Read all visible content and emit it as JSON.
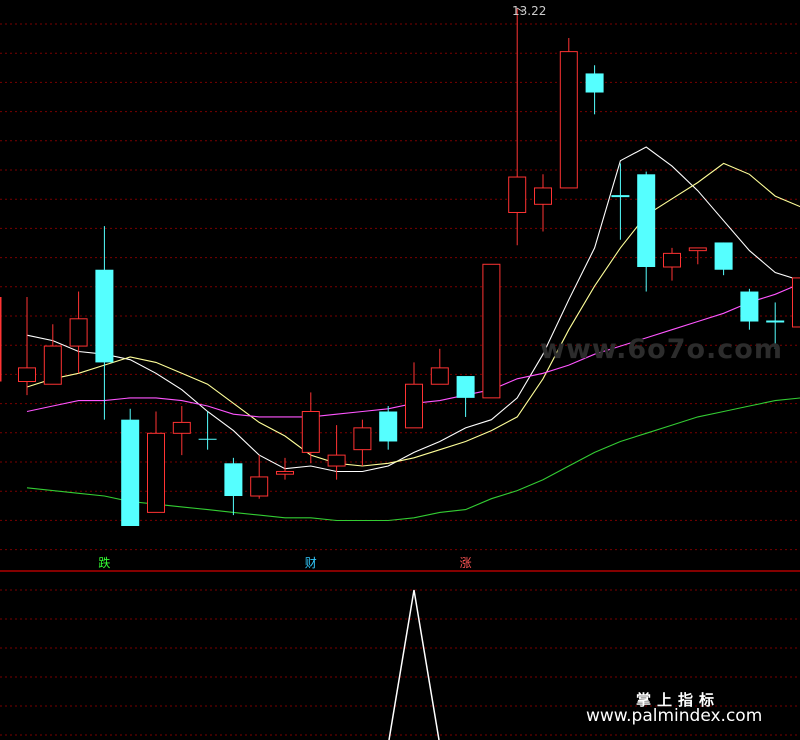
{
  "chart_data": {
    "type": "candlestick",
    "candles": [
      {
        "o": 11.9,
        "h": 12.16,
        "l": 11.8,
        "c": 11.85,
        "dir": "up"
      },
      {
        "o": 11.84,
        "h": 12.06,
        "l": 11.84,
        "c": 11.98,
        "dir": "up"
      },
      {
        "o": 11.98,
        "h": 12.18,
        "l": 11.88,
        "c": 12.08,
        "dir": "up"
      },
      {
        "o": 12.26,
        "h": 12.42,
        "l": 11.71,
        "c": 11.92,
        "dir": "down"
      },
      {
        "o": 11.71,
        "h": 11.75,
        "l": 11.33,
        "c": 11.32,
        "dir": "down"
      },
      {
        "o": 11.37,
        "h": 11.74,
        "l": 11.37,
        "c": 11.66,
        "dir": "up"
      },
      {
        "o": 11.66,
        "h": 11.76,
        "l": 11.58,
        "c": 11.7,
        "dir": "up"
      },
      {
        "o": 11.64,
        "h": 11.74,
        "l": 11.6,
        "c": 11.64,
        "dir": "down"
      },
      {
        "o": 11.55,
        "h": 11.57,
        "l": 11.36,
        "c": 11.43,
        "dir": "down"
      },
      {
        "o": 11.43,
        "h": 11.58,
        "l": 11.42,
        "c": 11.5,
        "dir": "up"
      },
      {
        "o": 11.51,
        "h": 11.57,
        "l": 11.49,
        "c": 11.52,
        "dir": "up"
      },
      {
        "o": 11.59,
        "h": 11.81,
        "l": 11.55,
        "c": 11.74,
        "dir": "up"
      },
      {
        "o": 11.54,
        "h": 11.69,
        "l": 11.49,
        "c": 11.58,
        "dir": "up"
      },
      {
        "o": 11.6,
        "h": 11.71,
        "l": 11.54,
        "c": 11.68,
        "dir": "up"
      },
      {
        "o": 11.74,
        "h": 11.76,
        "l": 11.6,
        "c": 11.63,
        "dir": "down"
      },
      {
        "o": 11.68,
        "h": 11.92,
        "l": 11.68,
        "c": 11.84,
        "dir": "up"
      },
      {
        "o": 11.84,
        "h": 11.97,
        "l": 11.84,
        "c": 11.9,
        "dir": "up"
      },
      {
        "o": 11.87,
        "h": 11.82,
        "l": 11.72,
        "c": 11.79,
        "dir": "down"
      },
      {
        "o": 11.79,
        "h": 12.28,
        "l": 11.79,
        "c": 12.28,
        "dir": "up"
      },
      {
        "o": 12.47,
        "h": 13.22,
        "l": 12.35,
        "c": 12.6,
        "dir": "up"
      },
      {
        "o": 12.5,
        "h": 12.61,
        "l": 12.4,
        "c": 12.56,
        "dir": "up"
      },
      {
        "o": 12.56,
        "h": 13.11,
        "l": 12.56,
        "c": 13.06,
        "dir": "up"
      },
      {
        "o": 12.98,
        "h": 13.01,
        "l": 12.83,
        "c": 12.91,
        "dir": "down"
      },
      {
        "o": 12.53,
        "h": 12.65,
        "l": 12.37,
        "c": 12.53,
        "dir": "doji"
      },
      {
        "o": 12.61,
        "h": 12.62,
        "l": 12.18,
        "c": 12.27,
        "dir": "down"
      },
      {
        "o": 12.27,
        "h": 12.34,
        "l": 12.22,
        "c": 12.32,
        "dir": "up"
      },
      {
        "o": 12.34,
        "h": 12.34,
        "l": 12.28,
        "c": 12.33,
        "dir": "up"
      },
      {
        "o": 12.36,
        "h": 12.36,
        "l": 12.24,
        "c": 12.26,
        "dir": "down"
      },
      {
        "o": 12.18,
        "h": 12.19,
        "l": 12.04,
        "c": 12.07,
        "dir": "down"
      },
      {
        "o": 12.07,
        "h": 12.14,
        "l": 11.97,
        "c": 12.06,
        "dir": "doji"
      },
      {
        "o": 12.05,
        "h": 12.26,
        "l": 11.92,
        "c": 12.23,
        "dir": "up"
      }
    ],
    "ma_lines": [
      {
        "color": "#ffffff",
        "values": [
          12.02,
          12.0,
          11.96,
          11.95,
          11.93,
          11.88,
          11.82,
          11.74,
          11.67,
          11.58,
          11.53,
          11.54,
          11.52,
          11.52,
          11.54,
          11.59,
          11.63,
          11.68,
          11.71,
          11.79,
          11.95,
          12.15,
          12.34,
          12.66,
          12.71,
          12.64,
          12.55,
          12.44,
          12.33,
          12.25,
          12.22
        ]
      },
      {
        "color": "#ffff99",
        "values": [
          11.83,
          11.86,
          11.88,
          11.91,
          11.94,
          11.92,
          11.88,
          11.84,
          11.77,
          11.7,
          11.65,
          11.58,
          11.55,
          11.54,
          11.55,
          11.57,
          11.6,
          11.63,
          11.67,
          11.72,
          11.86,
          12.04,
          12.2,
          12.34,
          12.46,
          12.52,
          12.58,
          12.65,
          12.61,
          12.53,
          12.49
        ]
      },
      {
        "color": "#ff55ff",
        "values": [
          11.74,
          11.76,
          11.78,
          11.78,
          11.79,
          11.79,
          11.78,
          11.76,
          11.73,
          11.72,
          11.72,
          11.72,
          11.73,
          11.74,
          11.75,
          11.77,
          11.78,
          11.8,
          11.82,
          11.86,
          11.88,
          11.91,
          11.95,
          11.98,
          12.01,
          12.04,
          12.07,
          12.1,
          12.14,
          12.17,
          12.21
        ]
      },
      {
        "color": "#33cc33",
        "values": [
          11.46,
          11.45,
          11.44,
          11.43,
          11.41,
          11.4,
          11.39,
          11.38,
          11.37,
          11.36,
          11.35,
          11.35,
          11.34,
          11.34,
          11.34,
          11.35,
          11.37,
          11.38,
          11.42,
          11.45,
          11.49,
          11.54,
          11.59,
          11.63,
          11.66,
          11.69,
          11.72,
          11.74,
          11.76,
          11.78,
          11.79
        ]
      }
    ],
    "high_label": "13.22",
    "markers": [
      {
        "text": "跌",
        "index": 3,
        "color": "#33ff33"
      },
      {
        "text": "财",
        "index": 11,
        "color": "#33ccff"
      },
      {
        "text": "涨",
        "index": 17,
        "color": "#ff5555"
      }
    ],
    "sub_indicator": {
      "values": [
        0,
        0,
        0,
        0,
        0,
        0,
        0,
        0,
        0,
        0,
        0,
        0,
        0,
        0,
        0,
        1,
        0,
        0,
        0,
        0,
        0,
        0,
        0,
        0,
        0,
        0,
        0,
        0,
        0,
        0,
        0
      ]
    },
    "colors": {
      "up": "#ff3333",
      "down": "#55ffff",
      "grid": "#7a0000",
      "divider": "#b00000"
    }
  },
  "watermarks": {
    "center": "www.6o7o.com",
    "bottom_title": "掌上指标",
    "bottom_url": "www.palmindex.com"
  }
}
